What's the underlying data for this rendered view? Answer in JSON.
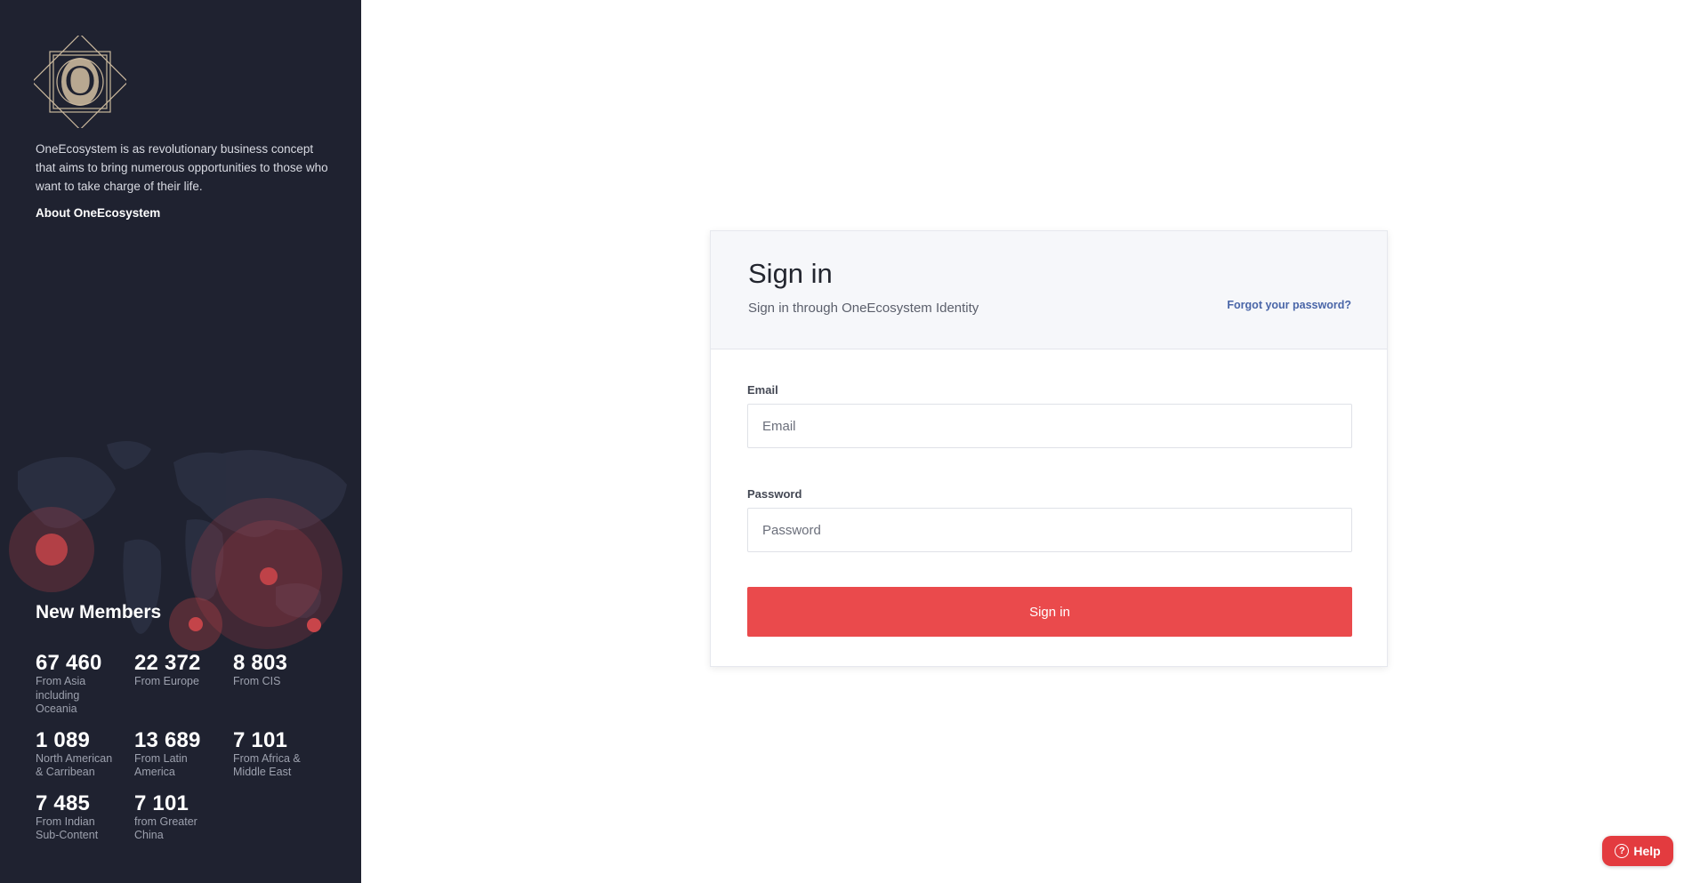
{
  "sidebar": {
    "logo_letter": "O",
    "intro": "OneEcosystem is as revolutionary business concept that aims to bring numerous opportunities to those who want to take charge of their life.",
    "about_link": "About OneEcosystem",
    "new_members_title": "New Members",
    "stats": [
      {
        "value": "67 460",
        "label": "From Asia including Oceania"
      },
      {
        "value": "22 372",
        "label": "From Europe"
      },
      {
        "value": "8 803",
        "label": "From CIS"
      },
      {
        "value": "1 089",
        "label": "North American & Carribean"
      },
      {
        "value": "13 689",
        "label": "From Latin America"
      },
      {
        "value": "7 101",
        "label": "From Africa & Middle East"
      },
      {
        "value": "7 485",
        "label": "From Indian Sub-Content"
      },
      {
        "value": "7 101",
        "label": "from Greater China"
      }
    ]
  },
  "signin": {
    "title": "Sign in",
    "subtitle": "Sign in through OneEcosystem Identity",
    "forgot": "Forgot your password?",
    "email_label": "Email",
    "email_placeholder": "Email",
    "password_label": "Password",
    "password_placeholder": "Password",
    "submit": "Sign in"
  },
  "help": {
    "label": "Help",
    "icon": "?"
  },
  "colors": {
    "sidebar_bg": "#1f2230",
    "accent": "#ea4a4c",
    "link": "#4a66a8"
  }
}
